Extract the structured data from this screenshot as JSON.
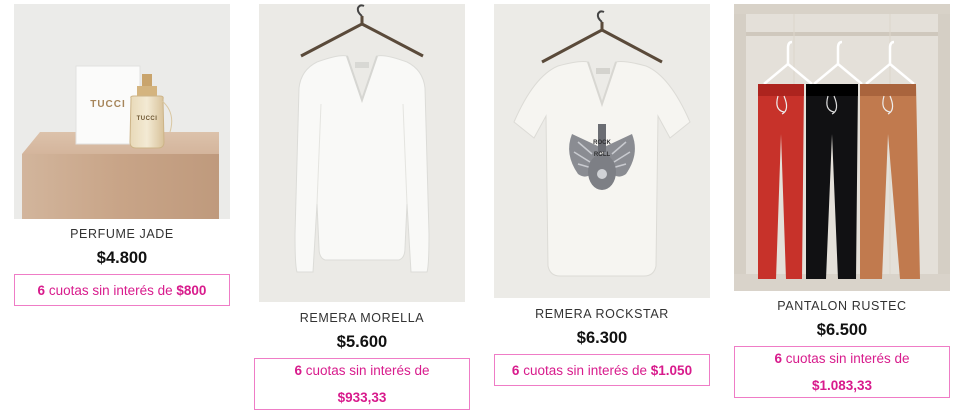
{
  "products": [
    {
      "name": "PERFUME JADE",
      "price": "$4.800",
      "installments": {
        "count": "6",
        "text": "cuotas sin interés de",
        "amount": "$800"
      },
      "image_brand": "TUCCI"
    },
    {
      "name": "REMERA MORELLA",
      "price": "$5.600",
      "installments": {
        "count": "6",
        "text": "cuotas sin interés de",
        "amount": "$933,33"
      }
    },
    {
      "name": "REMERA ROCKSTAR",
      "price": "$6.300",
      "installments": {
        "count": "6",
        "text": "cuotas sin interés de",
        "amount": "$1.050"
      }
    },
    {
      "name": "PANTALON RUSTEC",
      "price": "$6.500",
      "installments": {
        "count": "6",
        "text": "cuotas sin interés de",
        "amount": "$1.083,33"
      }
    }
  ],
  "colors": {
    "accent": "#d81b8c",
    "installment_border": "#ef7cc6"
  }
}
